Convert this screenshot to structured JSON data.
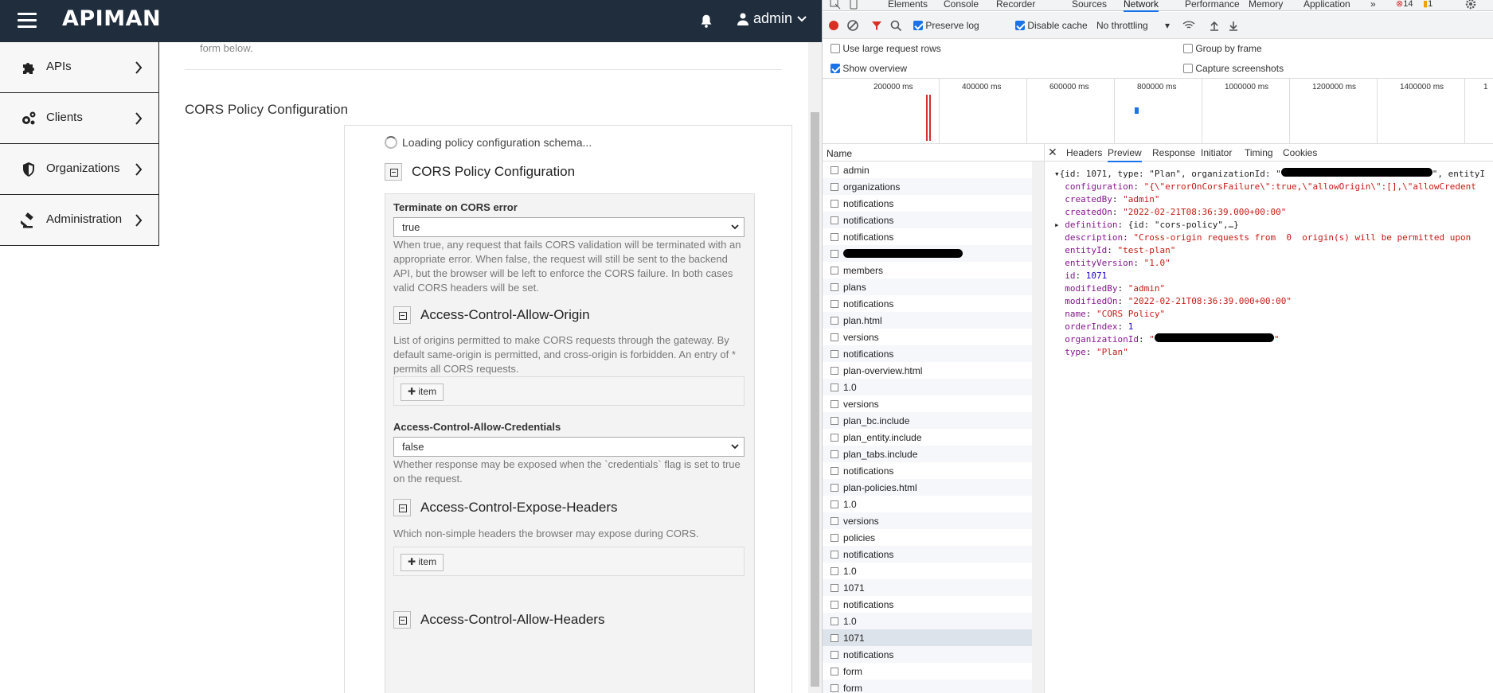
{
  "app": {
    "logo_text": "APIMAN",
    "user_label": "admin",
    "sidebar": [
      {
        "label": "APIs",
        "icon": "puzzle-icon"
      },
      {
        "label": "Clients",
        "icon": "gears-icon"
      },
      {
        "label": "Organizations",
        "icon": "shield-icon"
      },
      {
        "label": "Administration",
        "icon": "gavel-icon"
      }
    ],
    "main": {
      "intro_tail": "form below.",
      "section_title": "CORS Policy Configuration",
      "loading_text": "Loading policy configuration schema...",
      "config_title": "CORS Policy Configuration",
      "terminate_label": "Terminate on CORS error",
      "terminate_value": "true",
      "terminate_help": "When true, any request that fails CORS validation will be terminated with an appropriate error. When false, the request will still be sent to the backend API, but the browser will be left to enforce the CORS failure. In both cases valid CORS headers will be set.",
      "allow_origin_title": "Access-Control-Allow-Origin",
      "allow_origin_help": "List of origins permitted to make CORS requests through the gateway. By default same-origin is permitted, and cross-origin is forbidden. An entry of * permits all CORS requests.",
      "item_button": "item",
      "allow_credentials_label": "Access-Control-Allow-Credentials",
      "allow_credentials_value": "false",
      "allow_credentials_help": "Whether response may be exposed when the `credentials` flag is set to true on the request.",
      "expose_headers_title": "Access-Control-Expose-Headers",
      "expose_headers_help": "Which non-simple headers the browser may expose during CORS.",
      "allow_headers_title": "Access-Control-Allow-Headers"
    }
  },
  "devtools": {
    "tabs": [
      "Elements",
      "Console",
      "Recorder",
      "Sources",
      "Network",
      "Performance",
      "Memory",
      "Application"
    ],
    "active_tab": "Network",
    "more_tabs": "»",
    "error_count": "14",
    "warning_count": "1",
    "toolbar": {
      "preserve_log": "Preserve log",
      "disable_cache": "Disable cache",
      "throttling": "No throttling"
    },
    "options": {
      "large_rows": "Use large request rows",
      "group_by_frame": "Group by frame",
      "show_overview": "Show overview",
      "capture_screenshots": "Capture screenshots"
    },
    "overview_ticks": [
      "200000 ms",
      "400000 ms",
      "600000 ms",
      "800000 ms",
      "1000000 ms",
      "1200000 ms",
      "1400000 ms",
      "1"
    ],
    "name_header": "Name",
    "requests": [
      "admin",
      "organizations",
      "notifications",
      "notifications",
      "notifications",
      "",
      "members",
      "plans",
      "notifications",
      "plan.html",
      "versions",
      "notifications",
      "plan-overview.html",
      "1.0",
      "versions",
      "plan_bc.include",
      "plan_entity.include",
      "plan_tabs.include",
      "notifications",
      "plan-policies.html",
      "1.0",
      "versions",
      "policies",
      "notifications",
      "1.0",
      "1071",
      "notifications",
      "1.0",
      "1071",
      "notifications",
      "form",
      "form"
    ],
    "detail_tabs": [
      "Headers",
      "Preview",
      "Response",
      "Initiator",
      "Timing",
      "Cookies"
    ],
    "active_detail_tab": "Preview",
    "preview": {
      "summary": "{id: 1071, type: \"Plan\", organizationId: \"",
      "summary_tail": "\", entityI",
      "configuration": "\"{\\\"errorOnCorsFailure\\\":true,\\\"allowOrigin\\\":[],\\\"allowCredent",
      "createdBy": "\"admin\"",
      "createdOn": "\"2022-02-21T08:36:39.000+00:00\"",
      "definition": "{id: \"cors-policy\",…}",
      "description": "\"Cross-origin requests from  0  origin(s) will be permitted upon",
      "entityId": "\"test-plan\"",
      "entityVersion": "\"1.0\"",
      "id": "1071",
      "modifiedBy": "\"admin\"",
      "modifiedOn": "\"2022-02-21T08:36:39.000+00:00\"",
      "name": "\"CORS Policy\"",
      "orderIndex": "1",
      "organizationId": "\"",
      "organizationId_tail": "\"",
      "type": "\"Plan\""
    }
  }
}
